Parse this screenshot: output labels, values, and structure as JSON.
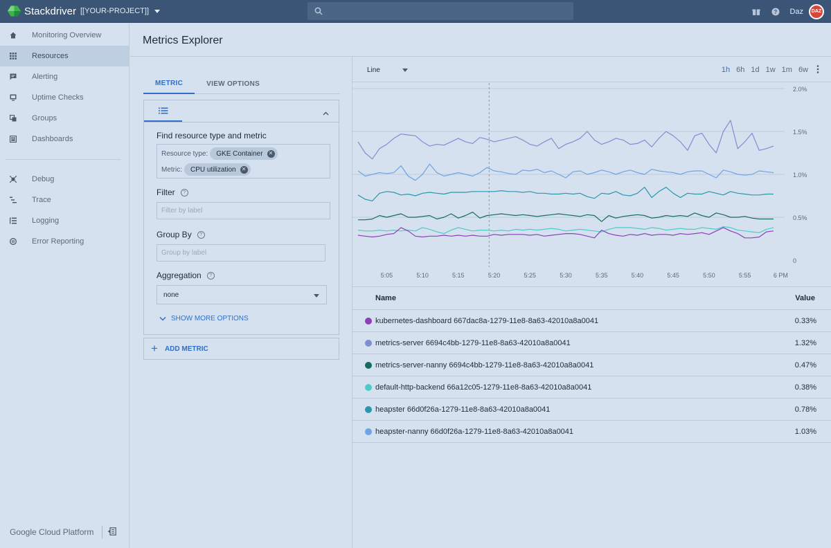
{
  "topbar": {
    "brand": "Stackdriver",
    "project": "[[YOUR-PROJECT]]",
    "search_placeholder": "",
    "user": "Daz",
    "avatar_text": "DAZ"
  },
  "sidebar": {
    "items": [
      {
        "label": "Monitoring Overview",
        "icon": "home-icon",
        "active": false
      },
      {
        "label": "Resources",
        "icon": "grid-icon",
        "active": true
      },
      {
        "label": "Alerting",
        "icon": "alert-icon",
        "active": false
      },
      {
        "label": "Uptime Checks",
        "icon": "monitor-icon",
        "active": false
      },
      {
        "label": "Groups",
        "icon": "groups-icon",
        "active": false
      },
      {
        "label": "Dashboards",
        "icon": "dashboard-icon",
        "active": false
      },
      {
        "label": "Debug",
        "icon": "debug-icon",
        "active": false
      },
      {
        "label": "Trace",
        "icon": "trace-icon",
        "active": false
      },
      {
        "label": "Logging",
        "icon": "logging-icon",
        "active": false
      },
      {
        "label": "Error Reporting",
        "icon": "error-reporting-icon",
        "active": false
      }
    ],
    "footer": "Google Cloud Platform"
  },
  "page": {
    "title": "Metrics Explorer"
  },
  "builder": {
    "tabs": [
      "METRIC",
      "VIEW OPTIONS"
    ],
    "find_label": "Find resource type and metric",
    "resource_label": "Resource type:",
    "resource_value": "GKE Container",
    "metric_label": "Metric:",
    "metric_value": "CPU utilization",
    "filter_label": "Filter",
    "filter_placeholder": "Filter by label",
    "groupby_label": "Group By",
    "groupby_placeholder": "Group by label",
    "aggregation_label": "Aggregation",
    "aggregation_value": "none",
    "show_more": "SHOW MORE OPTIONS",
    "add_metric": "ADD METRIC"
  },
  "toolbar": {
    "chart_type": "Line",
    "ranges": [
      "1h",
      "6h",
      "1d",
      "1w",
      "1m",
      "6w"
    ],
    "active_range": "1h"
  },
  "chart_data": {
    "type": "line",
    "x_ticks": [
      "5:05",
      "5:10",
      "5:15",
      "5:20",
      "5:25",
      "5:30",
      "5:35",
      "5:40",
      "5:45",
      "5:50",
      "5:55",
      "6 PM"
    ],
    "y_ticks": [
      "0",
      "0.5%",
      "1.0%",
      "1.5%",
      "2.0%"
    ],
    "ylim": [
      0,
      2.0
    ],
    "x_domain_minutes": [
      1,
      59
    ],
    "cursor_minute": 19.3,
    "grid": true,
    "series": [
      {
        "name": "metrics-server 6694c4bb-1279-11e8-8a63-42010a8a0041",
        "color": "#7d8fd1",
        "values": [
          1.38,
          1.25,
          1.18,
          1.3,
          1.35,
          1.42,
          1.47,
          1.46,
          1.45,
          1.38,
          1.33,
          1.35,
          1.34,
          1.38,
          1.42,
          1.38,
          1.36,
          1.43,
          1.41,
          1.38,
          1.4,
          1.42,
          1.44,
          1.4,
          1.35,
          1.33,
          1.38,
          1.42,
          1.3,
          1.35,
          1.38,
          1.42,
          1.5,
          1.4,
          1.35,
          1.38,
          1.42,
          1.4,
          1.35,
          1.36,
          1.4,
          1.32,
          1.42,
          1.5,
          1.45,
          1.38,
          1.28,
          1.45,
          1.48,
          1.35,
          1.25,
          1.5,
          1.63,
          1.3,
          1.38,
          1.48,
          1.28,
          1.3,
          1.33
        ]
      },
      {
        "name": "heapster-nanny 66d0f26a-1279-11e8-8a63-42010a8a0041",
        "color": "#6fa4e4",
        "values": [
          1.04,
          0.98,
          1.0,
          1.02,
          1.01,
          1.02,
          1.1,
          0.98,
          0.93,
          1.0,
          1.12,
          1.02,
          0.98,
          1.0,
          1.02,
          1.0,
          0.98,
          1.02,
          1.08,
          1.04,
          1.03,
          1.01,
          1.0,
          1.05,
          1.04,
          1.06,
          1.02,
          1.04,
          1.0,
          0.96,
          1.03,
          1.04,
          1.0,
          1.02,
          1.05,
          1.03,
          1.0,
          1.03,
          1.05,
          1.02,
          1.0,
          1.06,
          1.04,
          1.03,
          1.02,
          1.0,
          1.03,
          1.04,
          1.04,
          1.0,
          0.96,
          1.05,
          1.03,
          1.0,
          0.99,
          1.0,
          1.04,
          1.03,
          1.02
        ]
      },
      {
        "name": "heapster 66d0f26a-1279-11e8-8a63-42010a8a0041",
        "color": "#2b96ad",
        "values": [
          0.76,
          0.71,
          0.69,
          0.78,
          0.8,
          0.79,
          0.76,
          0.77,
          0.75,
          0.78,
          0.79,
          0.78,
          0.77,
          0.79,
          0.79,
          0.79,
          0.8,
          0.8,
          0.8,
          0.8,
          0.81,
          0.8,
          0.8,
          0.79,
          0.8,
          0.78,
          0.78,
          0.77,
          0.77,
          0.78,
          0.77,
          0.78,
          0.74,
          0.72,
          0.78,
          0.77,
          0.8,
          0.76,
          0.75,
          0.78,
          0.85,
          0.73,
          0.8,
          0.85,
          0.78,
          0.73,
          0.78,
          0.77,
          0.77,
          0.8,
          0.78,
          0.76,
          0.8,
          0.78,
          0.77,
          0.76,
          0.76,
          0.77,
          0.77
        ]
      },
      {
        "name": "metrics-server-nanny 6694c4bb-1279-11e8-8a63-42010a8a0041",
        "color": "#156a63",
        "values": [
          0.47,
          0.47,
          0.48,
          0.52,
          0.5,
          0.52,
          0.54,
          0.5,
          0.5,
          0.51,
          0.52,
          0.48,
          0.5,
          0.54,
          0.49,
          0.52,
          0.56,
          0.49,
          0.52,
          0.53,
          0.54,
          0.53,
          0.52,
          0.53,
          0.52,
          0.51,
          0.52,
          0.53,
          0.54,
          0.53,
          0.52,
          0.51,
          0.53,
          0.52,
          0.45,
          0.52,
          0.49,
          0.51,
          0.52,
          0.53,
          0.52,
          0.49,
          0.5,
          0.52,
          0.51,
          0.52,
          0.51,
          0.55,
          0.52,
          0.5,
          0.55,
          0.53,
          0.5,
          0.5,
          0.51,
          0.49,
          0.48,
          0.48,
          0.48
        ]
      },
      {
        "name": "default-http-backend 66a12c05-1279-11e8-8a63-42010a8a0041",
        "color": "#4ccbc9",
        "values": [
          0.35,
          0.34,
          0.34,
          0.35,
          0.34,
          0.35,
          0.34,
          0.35,
          0.34,
          0.38,
          0.36,
          0.33,
          0.31,
          0.35,
          0.38,
          0.36,
          0.34,
          0.35,
          0.35,
          0.34,
          0.35,
          0.34,
          0.36,
          0.35,
          0.36,
          0.35,
          0.36,
          0.37,
          0.36,
          0.34,
          0.35,
          0.36,
          0.35,
          0.34,
          0.33,
          0.36,
          0.38,
          0.38,
          0.38,
          0.37,
          0.36,
          0.38,
          0.37,
          0.35,
          0.36,
          0.37,
          0.36,
          0.36,
          0.38,
          0.37,
          0.36,
          0.39,
          0.38,
          0.35,
          0.34,
          0.33,
          0.32,
          0.36,
          0.38
        ]
      },
      {
        "name": "kubernetes-dashboard 667dac8a-1279-11e8-8a63-42010a8a0041",
        "color": "#8d3fb7",
        "values": [
          0.29,
          0.28,
          0.27,
          0.28,
          0.3,
          0.31,
          0.38,
          0.34,
          0.28,
          0.27,
          0.28,
          0.28,
          0.29,
          0.28,
          0.29,
          0.28,
          0.29,
          0.28,
          0.28,
          0.3,
          0.29,
          0.3,
          0.3,
          0.3,
          0.29,
          0.3,
          0.28,
          0.29,
          0.3,
          0.31,
          0.31,
          0.3,
          0.28,
          0.26,
          0.35,
          0.31,
          0.29,
          0.28,
          0.3,
          0.29,
          0.31,
          0.29,
          0.3,
          0.3,
          0.29,
          0.31,
          0.3,
          0.31,
          0.32,
          0.3,
          0.34,
          0.38,
          0.34,
          0.31,
          0.26,
          0.26,
          0.27,
          0.33,
          0.34
        ]
      }
    ]
  },
  "legend_table": {
    "col_name": "Name",
    "col_value": "Value",
    "rows": [
      {
        "name": "kubernetes-dashboard 667dac8a-1279-11e8-8a63-42010a8a0041",
        "value": "0.33%",
        "color": "#8d3fb7"
      },
      {
        "name": "metrics-server 6694c4bb-1279-11e8-8a63-42010a8a0041",
        "value": "1.32%",
        "color": "#7d8fd1"
      },
      {
        "name": "metrics-server-nanny 6694c4bb-1279-11e8-8a63-42010a8a0041",
        "value": "0.47%",
        "color": "#156a63"
      },
      {
        "name": "default-http-backend 66a12c05-1279-11e8-8a63-42010a8a0041",
        "value": "0.38%",
        "color": "#4ccbc9"
      },
      {
        "name": "heapster 66d0f26a-1279-11e8-8a63-42010a8a0041",
        "value": "0.78%",
        "color": "#2b96ad"
      },
      {
        "name": "heapster-nanny 66d0f26a-1279-11e8-8a63-42010a8a0041",
        "value": "1.03%",
        "color": "#6fa4e4"
      }
    ]
  },
  "colors": {
    "accent": "#2f6fc7",
    "topbar": "#3b5576",
    "background": "#d5e1ef"
  }
}
